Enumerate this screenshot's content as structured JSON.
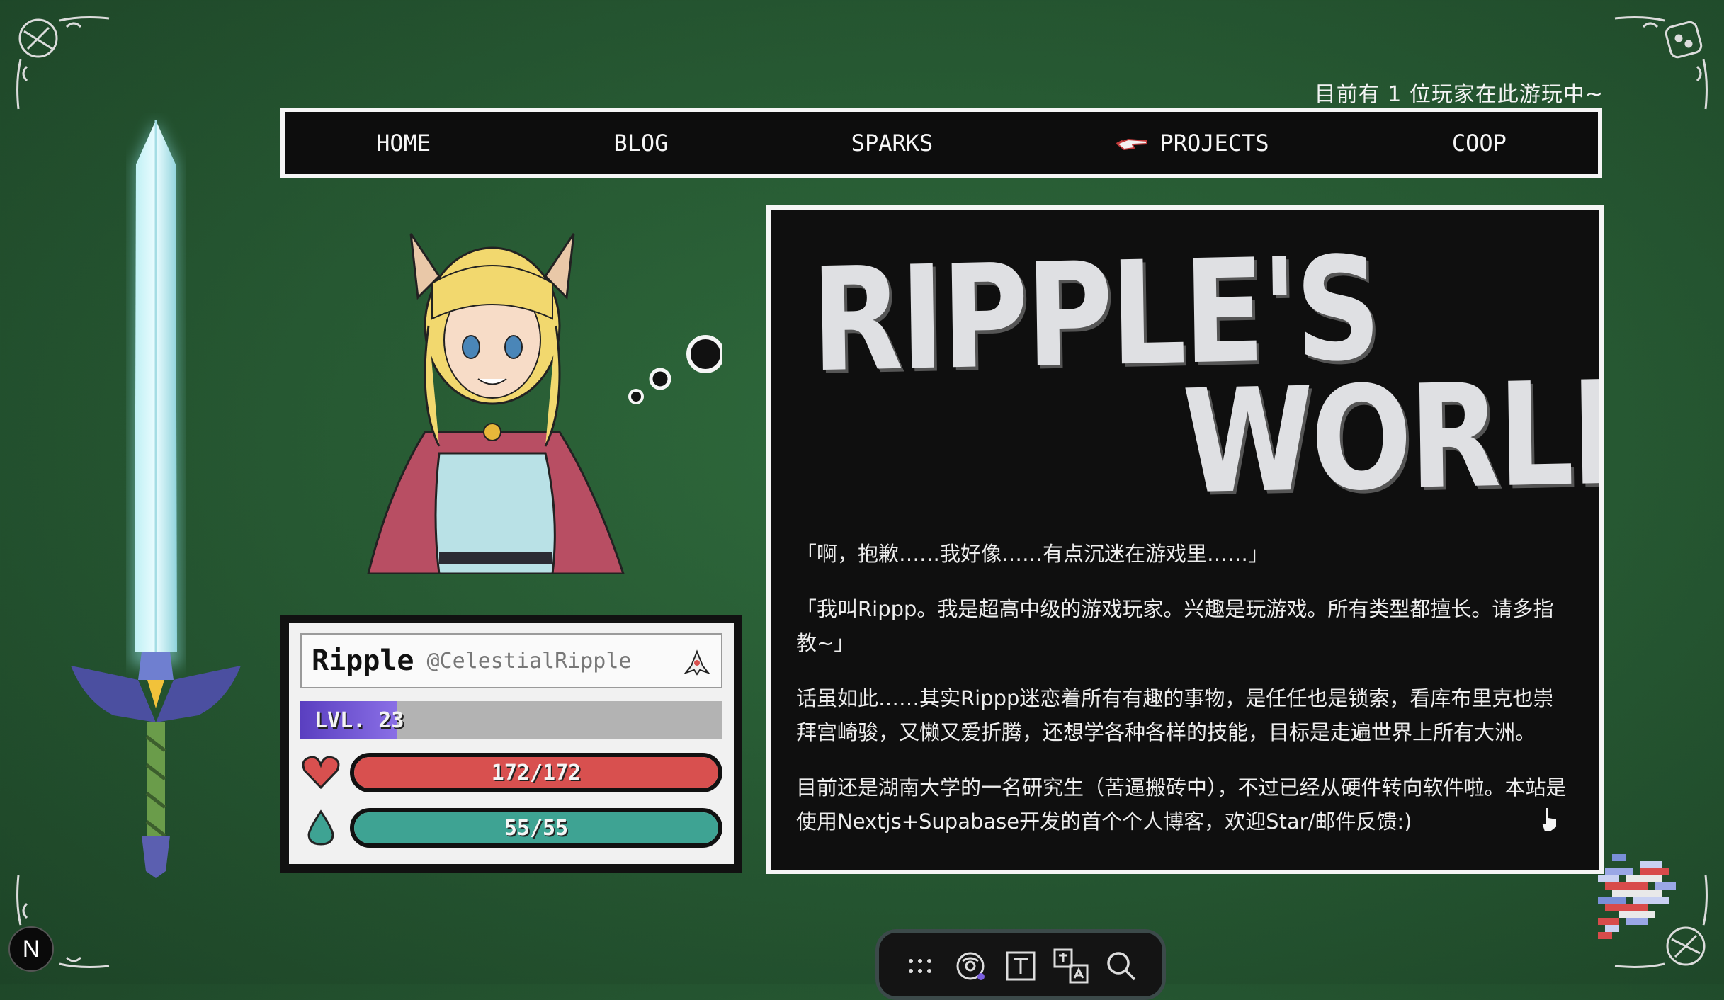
{
  "status": {
    "online_text": "目前有 1 位玩家在此游玩中~"
  },
  "nav": {
    "items": [
      {
        "label": "HOME"
      },
      {
        "label": "BLOG"
      },
      {
        "label": "SPARKS"
      },
      {
        "label": "PROJECTS",
        "icon": "pointing-hand-icon",
        "active": true
      },
      {
        "label": "COOP"
      }
    ]
  },
  "profile": {
    "name": "Ripple",
    "handle": "@CelestialRipple",
    "level_label": "LVL. 23",
    "level_progress": 0.23,
    "hp_text": "172/172",
    "hp_fraction": 1.0,
    "mp_text": "55/55",
    "mp_fraction": 1.0
  },
  "bio": {
    "title_line1": "RIPPLE'S",
    "title_line2": "WORLD",
    "paragraphs": [
      "「啊，抱歉……我好像……有点沉迷在游戏里……」",
      "「我叫Rippp。我是超高中级的游戏玩家。兴趣是玩游戏。所有类型都擅长。请多指教~」",
      "话虽如此……其实Rippp迷恋着所有有趣的事物，是任任也是锁索，看库布里克也崇拜宫崎骏，又懒又爱折腾，还想学各种各样的技能，目标是走遍世界上所有大洲。",
      "目前还是湖南大学的一名研究生（苦逼搬砖中），不过已经从硬件转向软件啦。本站是使用Nextjs+Supabase开发的首个个人博客，欢迎Star/邮件反馈:)"
    ]
  },
  "dock": {
    "buttons": [
      "grid-icon",
      "disc-icon",
      "text-icon",
      "translate-icon",
      "search-icon"
    ]
  },
  "badge": {
    "letter": "N"
  },
  "colors": {
    "background": "#275a33",
    "hp": "#d8504f",
    "mp": "#3ea393",
    "level": "#6a4fd0"
  }
}
